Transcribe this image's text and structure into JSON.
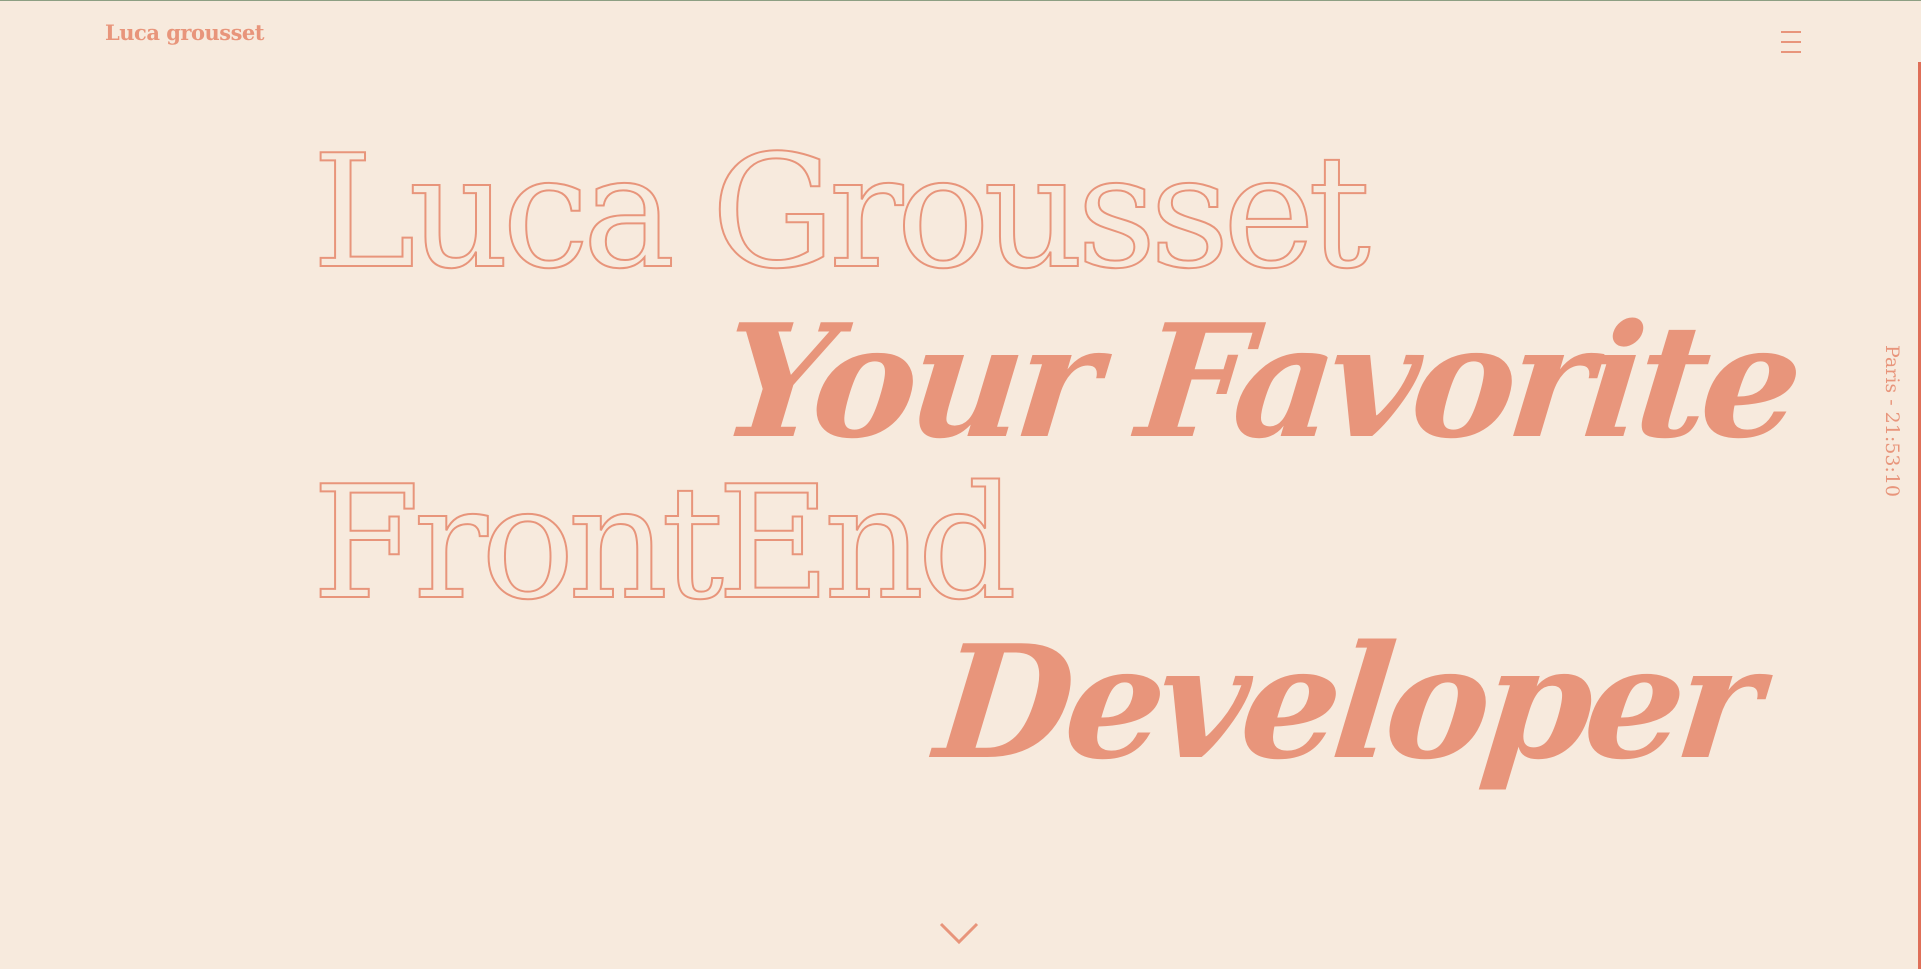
{
  "header": {
    "logo": "Luca grousset",
    "menu_icon": "hamburger-menu-icon"
  },
  "hero": {
    "line1": "Luca Grousset",
    "line2": "Your Favorite",
    "line3": "FrontEnd",
    "line4": "Developer"
  },
  "sidebar": {
    "clock": "Paris - 21:53:10"
  },
  "scroll": {
    "icon": "chevron-down-icon"
  },
  "colors": {
    "background": "#f7eadd",
    "accent": "#e8957b",
    "edge_accent": "#df6f58"
  }
}
